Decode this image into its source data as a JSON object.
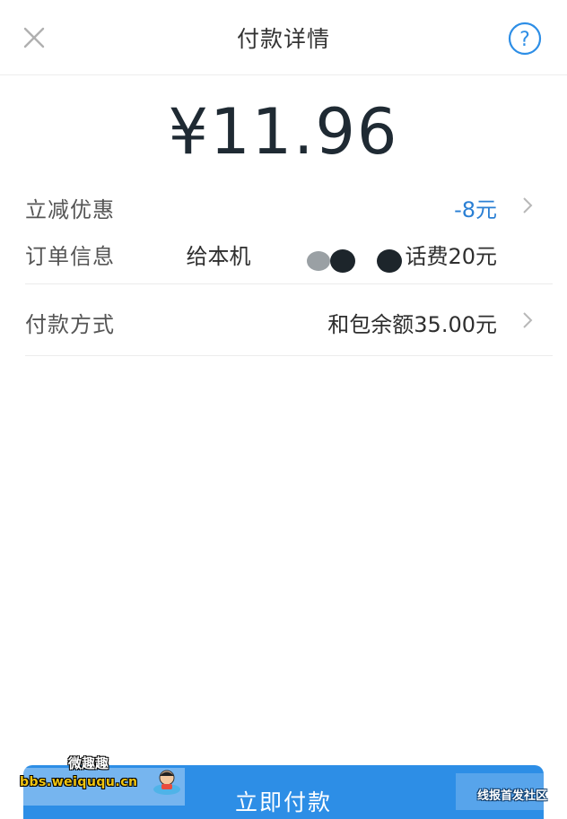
{
  "header": {
    "title": "付款详情",
    "close_icon": "close-icon",
    "help_icon": "help-icon"
  },
  "amount": {
    "display": "¥11.96"
  },
  "discount": {
    "label": "立减优惠",
    "value": "-8元"
  },
  "order": {
    "label": "订单信息",
    "value_prefix": "给本机",
    "value_suffix": "话费20元"
  },
  "payment": {
    "label": "付款方式",
    "value": "和包余额35.00元"
  },
  "pay_button": {
    "label": "立即付款"
  },
  "watermark": {
    "top_text": "微趣趣",
    "url": "bbs.weiququ.cn",
    "right_text": "线报首发社区"
  },
  "colors": {
    "accent": "#2d8ee6",
    "discount_blue": "#2a7fd4"
  }
}
